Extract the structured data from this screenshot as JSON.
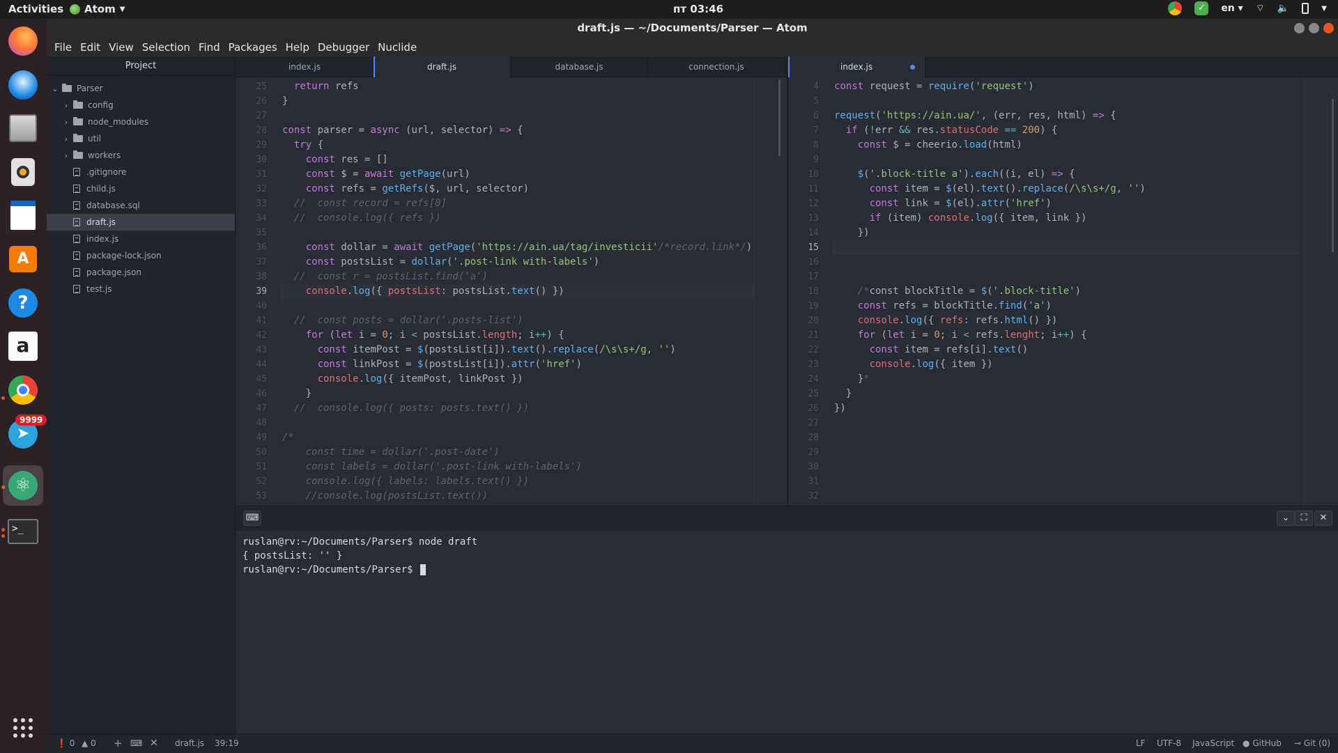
{
  "system": {
    "activities": "Activities",
    "app_name": "Atom",
    "clock": "пт 03:46",
    "language": "en"
  },
  "dock": {
    "items": [
      "firefox-icon",
      "thunderbird-icon",
      "files-icon",
      "rhythmbox-icon",
      "writer-icon",
      "software-center-icon",
      "help-icon",
      "amazon-icon",
      "chrome-icon",
      "telegram-icon",
      "atom-icon",
      "terminal-icon"
    ],
    "telegram_badge": "9999"
  },
  "window": {
    "title": "draft.js — ~/Documents/Parser — Atom"
  },
  "menu": [
    "File",
    "Edit",
    "View",
    "Selection",
    "Find",
    "Packages",
    "Help",
    "Debugger",
    "Nuclide"
  ],
  "tree": {
    "header": "Project",
    "root": "Parser",
    "folders": [
      "config",
      "node_modules",
      "util",
      "workers"
    ],
    "files": [
      ".gitignore",
      "child.js",
      "database.sql",
      "draft.js",
      "index.js",
      "package-lock.json",
      "package.json",
      "test.js"
    ],
    "selected": "draft.js"
  },
  "left_pane": {
    "tabs": [
      "index.js",
      "draft.js",
      "database.js",
      "connection.js"
    ],
    "active_tab": "draft.js",
    "first_line": 25,
    "current_line": 39,
    "lines": [
      [
        [
          "kw",
          "  return "
        ],
        [
          "",
          "refs"
        ]
      ],
      [
        [
          "",
          "}"
        ]
      ],
      [
        [
          "",
          ""
        ]
      ],
      [
        [
          "kw",
          "const "
        ],
        [
          "",
          "parser = "
        ],
        [
          "kw",
          "async "
        ],
        [
          "",
          "(url, selector) "
        ],
        [
          "kw",
          "=>"
        ],
        [
          "",
          " {"
        ]
      ],
      [
        [
          "kw",
          "  try "
        ],
        [
          "",
          "{"
        ]
      ],
      [
        [
          "kw",
          "    const "
        ],
        [
          "",
          "res = []"
        ]
      ],
      [
        [
          "kw",
          "    const "
        ],
        [
          "",
          "$ = "
        ],
        [
          "kw",
          "await "
        ],
        [
          "fn",
          "getPage"
        ],
        [
          "",
          "(url)"
        ]
      ],
      [
        [
          "kw",
          "    const "
        ],
        [
          "",
          "refs = "
        ],
        [
          "fn",
          "getRefs"
        ],
        [
          "",
          "($, url, selector)"
        ]
      ],
      [
        [
          "cm",
          "  //  const record = refs[0]"
        ]
      ],
      [
        [
          "cm",
          "  //  console.log({ refs })"
        ]
      ],
      [
        [
          "",
          ""
        ]
      ],
      [
        [
          "kw",
          "    const "
        ],
        [
          "",
          "dollar = "
        ],
        [
          "kw",
          "await "
        ],
        [
          "fn",
          "getPage"
        ],
        [
          "",
          "("
        ],
        [
          "str",
          "'https://ain.ua/tag/investicii'"
        ],
        [
          "cm",
          "/*record.link*/"
        ],
        [
          "",
          ")"
        ]
      ],
      [
        [
          "kw",
          "    const "
        ],
        [
          "",
          "postsList = "
        ],
        [
          "fn",
          "dollar"
        ],
        [
          "",
          "("
        ],
        [
          "str",
          "'.post-link with-labels'"
        ],
        [
          "",
          ")"
        ]
      ],
      [
        [
          "cm",
          "  //  const r = postsList.find('a')"
        ]
      ],
      [
        [
          "prop",
          "    console"
        ],
        [
          "",
          "."
        ],
        [
          "fn",
          "log"
        ],
        [
          "",
          "({ "
        ],
        [
          "prop",
          "postsList"
        ],
        [
          "",
          ": postsList."
        ],
        [
          "fn",
          "text"
        ],
        [
          "",
          "() })"
        ]
      ],
      [
        [
          "",
          ""
        ]
      ],
      [
        [
          "cm",
          "  //  const posts = dollar('.posts-list')"
        ]
      ],
      [
        [
          "kw",
          "    for "
        ],
        [
          "",
          "("
        ],
        [
          "kw",
          "let "
        ],
        [
          "",
          "i = "
        ],
        [
          "num",
          "0"
        ],
        [
          "",
          "; i "
        ],
        [
          "op",
          "<"
        ],
        [
          "",
          " postsList."
        ],
        [
          "prop",
          "length"
        ],
        [
          "",
          "; i"
        ],
        [
          "op",
          "++"
        ],
        [
          "",
          ") {"
        ]
      ],
      [
        [
          "kw",
          "      const "
        ],
        [
          "",
          "itemPost = "
        ],
        [
          "fn",
          "$"
        ],
        [
          "",
          "(postsList[i])."
        ],
        [
          "fn",
          "text"
        ],
        [
          "",
          "()."
        ],
        [
          "fn",
          "replace"
        ],
        [
          "",
          "("
        ],
        [
          "str",
          "/\\s\\s+/g"
        ],
        [
          "",
          ", "
        ],
        [
          "str",
          "''"
        ],
        [
          "",
          ")"
        ]
      ],
      [
        [
          "kw",
          "      const "
        ],
        [
          "",
          "linkPost = "
        ],
        [
          "fn",
          "$"
        ],
        [
          "",
          "(postsList[i])."
        ],
        [
          "fn",
          "attr"
        ],
        [
          "",
          "("
        ],
        [
          "str",
          "'href'"
        ],
        [
          "",
          ")"
        ]
      ],
      [
        [
          "prop",
          "      console"
        ],
        [
          "",
          "."
        ],
        [
          "fn",
          "log"
        ],
        [
          "",
          "({ itemPost, linkPost })"
        ]
      ],
      [
        [
          "",
          "    }"
        ]
      ],
      [
        [
          "cm",
          "  //  console.log({ posts: posts.text() })"
        ]
      ],
      [
        [
          "",
          ""
        ]
      ],
      [
        [
          "cm",
          "/*"
        ]
      ],
      [
        [
          "cm",
          "    const time = dollar('.post-date')"
        ]
      ],
      [
        [
          "cm",
          "    const labels = dollar('.post-link with-labels')"
        ]
      ],
      [
        [
          "cm",
          "    console.log({ labels: labels.text() })"
        ]
      ],
      [
        [
          "cm",
          "    //console.log(postsList.text())"
        ]
      ]
    ]
  },
  "right_pane": {
    "tabs": [
      "index.js"
    ],
    "active_tab": "index.js",
    "first_line": 4,
    "current_line": 15,
    "lines": [
      [
        [
          "kw",
          "const "
        ],
        [
          "",
          "request = "
        ],
        [
          "fn",
          "require"
        ],
        [
          "",
          "("
        ],
        [
          "str",
          "'request'"
        ],
        [
          "",
          ")"
        ]
      ],
      [
        [
          "",
          ""
        ]
      ],
      [
        [
          "fn",
          "request"
        ],
        [
          "",
          "("
        ],
        [
          "str",
          "'https://ain.ua/'"
        ],
        [
          "",
          ", (err, res, html) "
        ],
        [
          "kw",
          "=>"
        ],
        [
          "",
          " {"
        ]
      ],
      [
        [
          "kw",
          "  if "
        ],
        [
          "",
          "("
        ],
        [
          "op",
          "!"
        ],
        [
          "",
          "err "
        ],
        [
          "op",
          "&&"
        ],
        [
          "",
          " res."
        ],
        [
          "prop",
          "statusCode"
        ],
        [
          "",
          " "
        ],
        [
          "op",
          "=="
        ],
        [
          "",
          " "
        ],
        [
          "num",
          "200"
        ],
        [
          "",
          ") {"
        ]
      ],
      [
        [
          "kw",
          "    const "
        ],
        [
          "",
          "$ = cheerio."
        ],
        [
          "fn",
          "load"
        ],
        [
          "",
          "(html)"
        ]
      ],
      [
        [
          "",
          ""
        ]
      ],
      [
        [
          "fn",
          "    $"
        ],
        [
          "",
          "("
        ],
        [
          "str",
          "'.block-title a'"
        ],
        [
          "",
          ")."
        ],
        [
          "fn",
          "each"
        ],
        [
          "",
          "((i, el) "
        ],
        [
          "kw",
          "=>"
        ],
        [
          "",
          " {"
        ]
      ],
      [
        [
          "kw",
          "      const "
        ],
        [
          "",
          "item = "
        ],
        [
          "fn",
          "$"
        ],
        [
          "",
          "(el)."
        ],
        [
          "fn",
          "text"
        ],
        [
          "",
          "()."
        ],
        [
          "fn",
          "replace"
        ],
        [
          "",
          "("
        ],
        [
          "str",
          "/\\s\\s+/g"
        ],
        [
          "",
          ", "
        ],
        [
          "str",
          "''"
        ],
        [
          "",
          ")"
        ]
      ],
      [
        [
          "kw",
          "      const "
        ],
        [
          "",
          "link = "
        ],
        [
          "fn",
          "$"
        ],
        [
          "",
          "(el)."
        ],
        [
          "fn",
          "attr"
        ],
        [
          "",
          "("
        ],
        [
          "str",
          "'href'"
        ],
        [
          "",
          ")"
        ]
      ],
      [
        [
          "kw",
          "      if "
        ],
        [
          "",
          "(item) "
        ],
        [
          "prop",
          "console"
        ],
        [
          "",
          "."
        ],
        [
          "fn",
          "log"
        ],
        [
          "",
          "({ item, link })"
        ]
      ],
      [
        [
          "",
          "    })"
        ]
      ],
      [
        [
          "",
          ""
        ]
      ],
      [
        [
          "",
          ""
        ]
      ],
      [
        [
          "",
          ""
        ]
      ],
      [
        [
          "cm",
          "    /*"
        ],
        [
          "",
          "const blockTitle = "
        ],
        [
          "fn",
          "$"
        ],
        [
          "",
          "("
        ],
        [
          "str",
          "'.block-title'"
        ],
        [
          "",
          ")"
        ]
      ],
      [
        [
          "kw",
          "    const "
        ],
        [
          "",
          "refs = blockTitle."
        ],
        [
          "fn",
          "find"
        ],
        [
          "",
          "("
        ],
        [
          "str",
          "'a'"
        ],
        [
          "",
          ")"
        ]
      ],
      [
        [
          "prop",
          "    console"
        ],
        [
          "",
          "."
        ],
        [
          "fn",
          "log"
        ],
        [
          "",
          "({ "
        ],
        [
          "prop",
          "refs"
        ],
        [
          "",
          ": refs."
        ],
        [
          "fn",
          "html"
        ],
        [
          "",
          "() })"
        ]
      ],
      [
        [
          "kw",
          "    for "
        ],
        [
          "",
          "("
        ],
        [
          "kw",
          "let "
        ],
        [
          "",
          "i = "
        ],
        [
          "num",
          "0"
        ],
        [
          "",
          "; i "
        ],
        [
          "op",
          "<"
        ],
        [
          "",
          " refs."
        ],
        [
          "prop",
          "lenght"
        ],
        [
          "",
          "; i"
        ],
        [
          "op",
          "++"
        ],
        [
          "",
          ") {"
        ]
      ],
      [
        [
          "kw",
          "      const "
        ],
        [
          "",
          "item = refs[i]."
        ],
        [
          "fn",
          "text"
        ],
        [
          "",
          "()"
        ]
      ],
      [
        [
          "prop",
          "      console"
        ],
        [
          "",
          "."
        ],
        [
          "fn",
          "log"
        ],
        [
          "",
          "({ item })"
        ]
      ],
      [
        [
          "",
          "    }"
        ],
        [
          "cm",
          "*"
        ]
      ],
      [
        [
          "",
          "  }"
        ]
      ],
      [
        [
          "",
          "})"
        ]
      ],
      [
        [
          "",
          ""
        ]
      ],
      [
        [
          "",
          ""
        ]
      ],
      [
        [
          "",
          ""
        ]
      ],
      [
        [
          "",
          ""
        ]
      ],
      [
        [
          "",
          ""
        ]
      ],
      [
        [
          "",
          ""
        ]
      ]
    ]
  },
  "terminal": {
    "lines": [
      "ruslan@rv:~/Documents/Parser$ node draft",
      "{ postsList: '' }",
      "ruslan@rv:~/Documents/Parser$ "
    ]
  },
  "status": {
    "errors": "0",
    "warnings": "0",
    "file": "draft.js",
    "position": "39:19",
    "line_ending": "LF",
    "encoding": "UTF-8",
    "grammar": "JavaScript",
    "github": "GitHub",
    "git": "Git (0)"
  }
}
